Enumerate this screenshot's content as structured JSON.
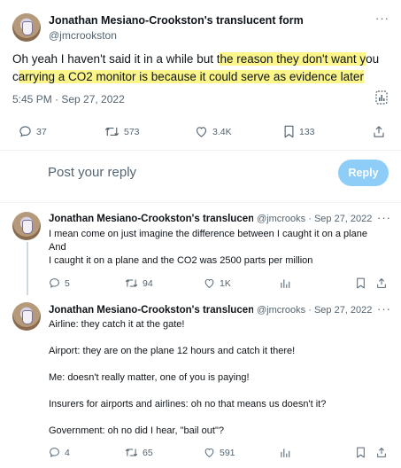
{
  "main_tweet": {
    "author_name": "Jonathan Mesiano-Crookston's translucent form",
    "handle": "@jmcrookston",
    "text_before_highlight": "Oh yeah I haven't said it in a while but t",
    "text_highlight_1": "he reason they don't want y",
    "text_mid": "ou c",
    "text_highlight_2": "arrying a CO2 monitor is because it could serve as evidence later",
    "timestamp": "5:45 PM · Sep 27, 2022",
    "replies": "37",
    "retweets": "573",
    "likes": "3.4K",
    "bookmarks": "133"
  },
  "composer": {
    "placeholder": "Post your reply",
    "reply_button_label": "Reply"
  },
  "replies": [
    {
      "author_name": "Jonathan Mesiano-Crookston's translucent form",
      "handle_date": "@jmcrooks · Sep 27, 2022",
      "lines": [
        "I mean come on just imagine the difference between I caught it on a plane",
        "And",
        "I caught it on a plane and the CO2 was 2500 parts per million"
      ],
      "replies": "5",
      "retweets": "94",
      "likes": "1K"
    },
    {
      "author_name": "Jonathan Mesiano-Crookston's translucent form",
      "handle_date": "@jmcrooks · Sep 27, 2022",
      "lines": [
        "Airline: they catch it at the gate!",
        "Airport: they are on the plane 12 hours and catch it there!",
        "Me: doesn't really matter, one of you is paying!",
        "Insurers for airports and airlines: oh no that means us doesn't it?",
        "Government: oh no did I hear, \"bail out\"?"
      ],
      "replies": "4",
      "retweets": "65",
      "likes": "591"
    }
  ],
  "icons": {
    "more": "more-icon",
    "reply": "reply-icon",
    "retweet": "retweet-icon",
    "like": "like-icon",
    "bookmark": "bookmark-icon",
    "share": "share-icon",
    "views": "views-icon",
    "analytics": "analytics-icon"
  },
  "colors": {
    "highlight": "#fbf58a",
    "reply_button": "#8ecdf8",
    "secondary_text": "#536471"
  }
}
